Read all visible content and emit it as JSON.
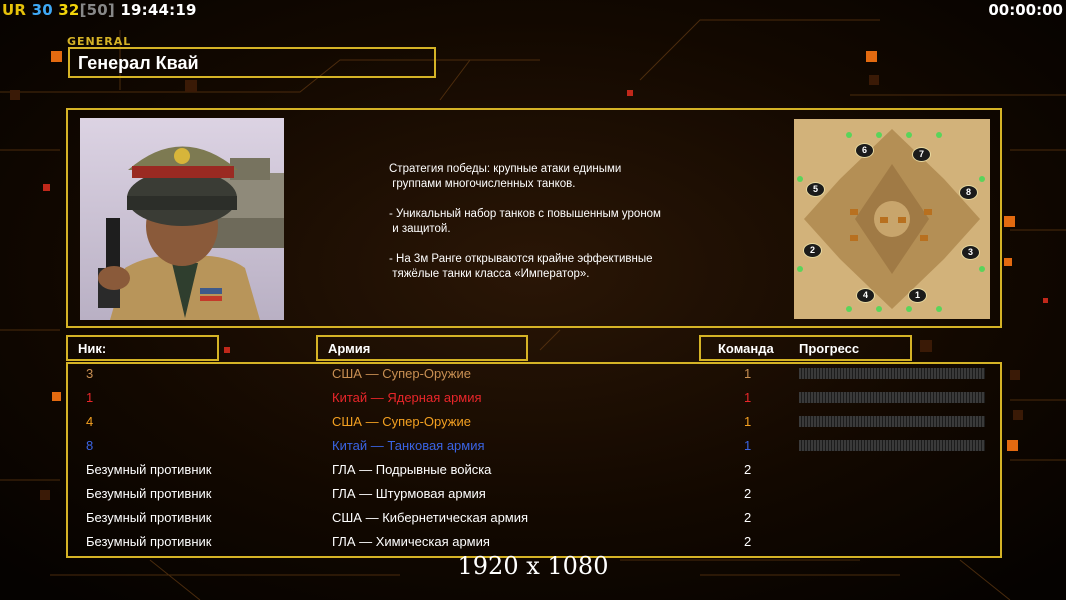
{
  "hud": {
    "ur_label": "UR",
    "num1": "30",
    "num2": "32",
    "num3": "[50]",
    "clock": "19:44:19",
    "timer": "00:00:00"
  },
  "general": {
    "tag": "GENERAL",
    "name": "Генерал Квай"
  },
  "description": "Стратегия победы: крупные атаки едиными\n группами многочисленных танков.\n\n- Уникальный набор танков с повышенным уроном\n и защитой.\n\n- На 3м Ранге открываются крайне эффективные\n тяжёлые танки класса «Император».",
  "map_slots": [
    "6",
    "7",
    "5",
    "8",
    "2",
    "3",
    "4",
    "1"
  ],
  "headers": {
    "nick": "Ник:",
    "army": "Армия",
    "team": "Команда",
    "progress": "Прогресс"
  },
  "players": [
    {
      "nick": "3",
      "army": "США — Супер-Оружие",
      "team": "1",
      "color": "#c88f52",
      "progress": true
    },
    {
      "nick": "1",
      "army": "Китай — Ядерная армия",
      "team": "1",
      "color": "#e8262a",
      "progress": true
    },
    {
      "nick": "4",
      "army": "США — Супер-Оружие",
      "team": "1",
      "color": "#f3a021",
      "progress": true
    },
    {
      "nick": "8",
      "army": "Китай — Танковая армия",
      "team": "1",
      "color": "#3a64e3",
      "progress": true
    },
    {
      "nick": "Безумный противник",
      "army": "ГЛА — Подрывные войска",
      "team": "2",
      "color": "#ffffff",
      "progress": false
    },
    {
      "nick": "Безумный противник",
      "army": "ГЛА — Штурмовая армия",
      "team": "2",
      "color": "#ffffff",
      "progress": false
    },
    {
      "nick": "Безумный противник",
      "army": "США — Кибернетическая армия",
      "team": "2",
      "color": "#ffffff",
      "progress": false
    },
    {
      "nick": "Безумный противник",
      "army": "ГЛА — Химическая армия",
      "team": "2",
      "color": "#ffffff",
      "progress": false
    }
  ],
  "resolution": "1920 x 1080",
  "colors": {
    "accent": "#d5b326",
    "ur": "#e6c20a",
    "num1": "#3fa9f5",
    "num2": "#f3d50a",
    "num3": "#888888"
  }
}
